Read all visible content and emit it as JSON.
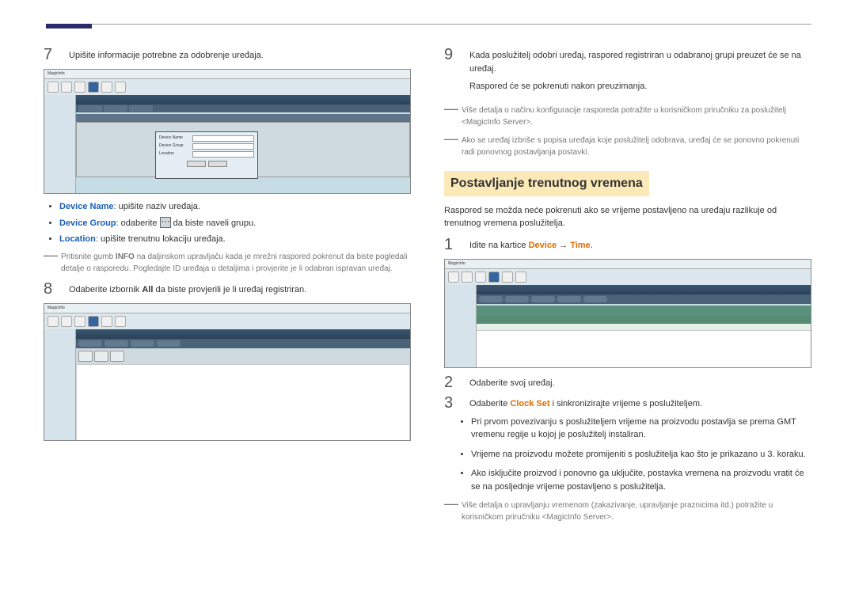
{
  "left": {
    "step7": {
      "num": "7",
      "text": "Upišite informacije potrebne za odobrenje uređaja.",
      "screenshot": {
        "appTitle": "MagicInfo",
        "approval": {
          "deviceName": "Device Name",
          "deviceGroup": "Device Group",
          "location": "Location",
          "ok": "OK",
          "cancel": "Cancel"
        }
      },
      "bullets": {
        "b1_label": "Device Name",
        "b1_text": ": upišite naziv uređaja.",
        "b2_label": "Device Group",
        "b2_pre": ": odaberite ",
        "b2_post": " da biste naveli grupu.",
        "b3_label": "Location",
        "b3_text": ": upišite trenutnu lokaciju uređaja."
      },
      "note": {
        "pre": "Pritisnite gumb ",
        "info": "INFO",
        "post": " na daljinskom upravljaču kada je mrežni raspored pokrenut da biste pogledali detalje o rasporedu. Pogledajte ID uređaja u detaljima i provjerite je li odabran ispravan uređaj."
      }
    },
    "step8": {
      "num": "8",
      "pre": "Odaberite izbornik ",
      "all": "All",
      "post": " da biste provjerili je li uređaj registriran."
    }
  },
  "right": {
    "step9": {
      "num": "9",
      "line1": "Kada poslužitelj odobri uređaj, raspored registriran u odabranoj grupi preuzet će se na uređaj.",
      "line2": "Raspored će se pokrenuti nakon preuzimanja."
    },
    "note1": "Više detalja o načinu konfiguracije rasporeda potražite u korisničkom priručniku za poslužitelj <MagicInfo Server>.",
    "note2": "Ako se uređaj izbriše s popisa uređaja koje poslužitelj odobrava, uređaj će se ponovno pokrenuti radi ponovnog postavljanja postavki.",
    "section": "Postavljanje trenutnog vremena",
    "intro": "Raspored se možda neće pokrenuti ako se vrijeme postavljeno na uređaju razlikuje od trenutnog vremena poslužitelja.",
    "step1": {
      "num": "1",
      "pre": "Idite na kartice ",
      "device": "Device",
      "arrow": " → ",
      "time": "Time",
      "post": "."
    },
    "step2": {
      "num": "2",
      "text": "Odaberite svoj uređaj."
    },
    "step3": {
      "num": "3",
      "pre": "Odaberite ",
      "clock": "Clock Set",
      "post": " i sinkronizirajte vrijeme s poslužiteljem.",
      "sb1": "Pri prvom povezivanju s poslužiteljem vrijeme na proizvodu postavlja se prema GMT vremenu regije u kojoj je poslužitelj instaliran.",
      "sb2": "Vrijeme na proizvodu možete promijeniti s poslužitelja kao što je prikazano u 3. koraku.",
      "sb3": "Ako isključite proizvod i ponovno ga uključite, postavka vremena na proizvodu vratit će se na posljednje vrijeme postavljeno s poslužitelja."
    },
    "note3": "Više detalja o upravljanju vremenom (zakazivanje, upravljanje praznicima itd.) potražite u korisničkom priručniku <MagicInfo Server>."
  }
}
